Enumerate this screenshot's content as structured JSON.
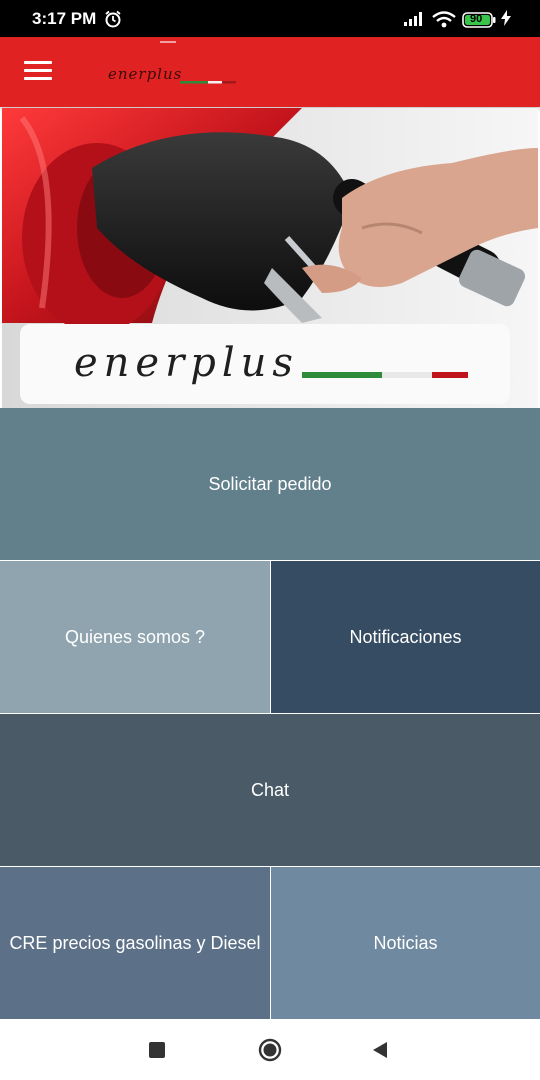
{
  "status_bar": {
    "time": "3:17 PM",
    "battery_level": "90",
    "icons": [
      "alarm-icon",
      "signal-icon",
      "wifi-icon",
      "battery-icon",
      "charging-icon"
    ]
  },
  "app_bar": {
    "logo_text": "enerplus",
    "menu_icon": "hamburger-menu-icon",
    "brand_color": "#e02222"
  },
  "hero": {
    "logo_text": "enerplus"
  },
  "tiles": [
    {
      "label": "Solicitar pedido",
      "color": "#627f8c"
    },
    {
      "label": "Quienes somos ?",
      "color": "#8fa4ae"
    },
    {
      "label": "Notificaciones",
      "color": "#354c62"
    },
    {
      "label": "Chat",
      "color": "#4a5a67"
    },
    {
      "label": "CRE precios gasolinas y Diesel",
      "color": "#5c7087"
    },
    {
      "label": "Noticias",
      "color": "#6f8aa0"
    }
  ],
  "nav_bar": {
    "icons": [
      "recent-apps-icon",
      "home-icon",
      "back-icon"
    ]
  }
}
